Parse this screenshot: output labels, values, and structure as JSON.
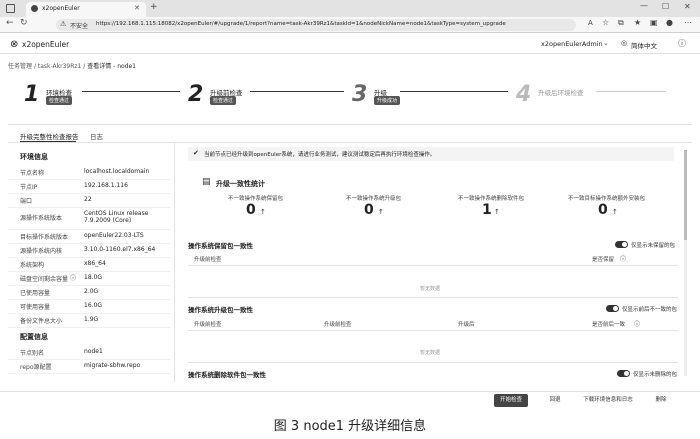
{
  "browser": {
    "tab_title": "x2openEuler",
    "security_label": "不安全",
    "url": "https://192.168.1.115:18082/x2openEuler/#/upgrade/1/report?name=task-Akr39Rz1&taskId=1&nodeNickName=node1&taskType=system_upgrade"
  },
  "header": {
    "logo_text": "x2openEuler",
    "user": "x2openEulerAdmin",
    "language": "简体中文"
  },
  "breadcrumb": {
    "items": [
      "任务管理",
      "task-Akr39Rz1",
      "查看详情 - node1"
    ]
  },
  "steps": [
    {
      "num": "1",
      "label": "环境检查",
      "status": "检查通过"
    },
    {
      "num": "2",
      "label": "升级前检查",
      "status": "检查通过"
    },
    {
      "num": "3",
      "label": "升级",
      "status": "升级成功"
    },
    {
      "num": "4",
      "label": "升级后环境检查",
      "status": ""
    }
  ],
  "tabs": {
    "report": "升级完整性检查报告",
    "log": "日志"
  },
  "env": {
    "title": "环境信息",
    "rows": [
      {
        "k": "节点名称",
        "v": "localhost.localdomain"
      },
      {
        "k": "节点IP",
        "v": "192.168.1.116"
      },
      {
        "k": "端口",
        "v": "22"
      },
      {
        "k": "源操作系统版本",
        "v": "CentOS Linux release 7.9.2009 (Core)"
      },
      {
        "k": "目标操作系统版本",
        "v": "openEuler22.03-LTS"
      },
      {
        "k": "源操作系统内核",
        "v": "3.10.0-1160.el7.x86_64"
      },
      {
        "k": "系统架构",
        "v": "x86_64"
      },
      {
        "k": "磁盘空间剩余容量",
        "v": "18.0G"
      },
      {
        "k": "已使用容量",
        "v": "2.0G"
      },
      {
        "k": "可使用容量",
        "v": "16.0G"
      },
      {
        "k": "备份文件总大小",
        "v": "1.9G"
      }
    ]
  },
  "config": {
    "title": "配置信息",
    "rows": [
      {
        "k": "节点别名",
        "v": "node1"
      },
      {
        "k": "repo源配置",
        "v": "migrate-sbhw.repo"
      }
    ]
  },
  "notice": "当前节点已经升级到openEuler系统，请进行业务测试，建议测试稳定后再执行环境检查操作。",
  "stats": {
    "title": "升级一致性统计",
    "items": [
      {
        "label": "不一致操作系统保留包",
        "value": "0"
      },
      {
        "label": "不一致操作系统升级包",
        "value": "0"
      },
      {
        "label": "不一致操作系统删除软件包",
        "value": "1"
      },
      {
        "label": "不一致目标操作系统额外安装包",
        "value": "0"
      }
    ]
  },
  "section_keep": {
    "title": "操作系统保留包一致性",
    "toggle_label": "仅显示未保留的包",
    "cols": [
      "升级前检查",
      "是否保留"
    ],
    "empty": "暂无数据"
  },
  "section_upgrade": {
    "title": "操作系统升级包一致性",
    "toggle_label": "仅显示前后不一致的包",
    "cols": [
      "升级前检查",
      "升级前检查",
      "升级后",
      "是否前后一致"
    ],
    "empty": "暂无数据"
  },
  "section_remove": {
    "title": "操作系统删除软件包一致性",
    "toggle_label": "仅显示未删除的包"
  },
  "footer": {
    "start": "开始检查",
    "rollback": "回退",
    "download": "下载环境信息和日志",
    "delete": "删除"
  },
  "caption": "图 3   node1 升级详细信息"
}
